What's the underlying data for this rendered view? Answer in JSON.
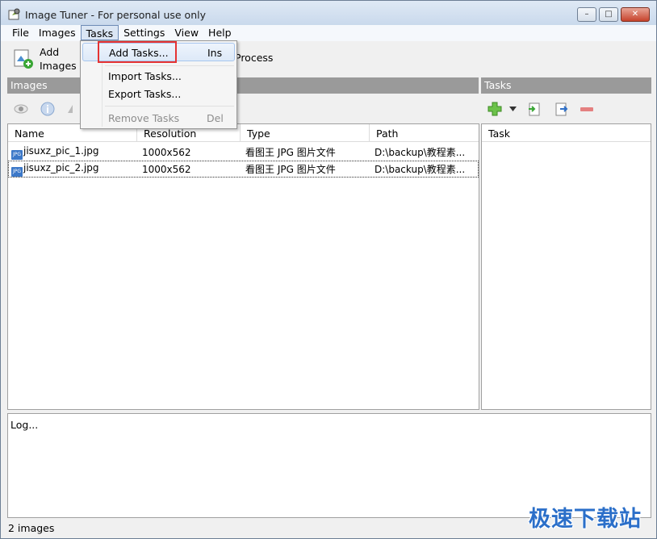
{
  "window": {
    "title": "Image Tuner - For personal use only"
  },
  "menubar": {
    "items": [
      "File",
      "Images",
      "Tasks",
      "Settings",
      "View",
      "Help"
    ],
    "active": "Tasks"
  },
  "toolbar": {
    "add_images_line1": "Add",
    "add_images_line2": "Images",
    "process_label": "Process"
  },
  "images_panel": {
    "header": "Images",
    "columns": [
      "Name",
      "Resolution",
      "Type",
      "Path"
    ],
    "rows": [
      {
        "name": "jisuxz_pic_1.jpg",
        "resolution": "1000x562",
        "type": "看图王 JPG 图片文件",
        "path": "D:\\backup\\教程素..."
      },
      {
        "name": "jisuxz_pic_2.jpg",
        "resolution": "1000x562",
        "type": "看图王 JPG 图片文件",
        "path": "D:\\backup\\教程素..."
      }
    ]
  },
  "tasks_panel": {
    "header": "Tasks",
    "columns": [
      "Task"
    ]
  },
  "dropdown": {
    "items": [
      {
        "label": "Add Tasks...",
        "shortcut": "Ins",
        "hover": true,
        "disabled": false
      },
      {
        "label": "Import Tasks...",
        "shortcut": "",
        "disabled": false
      },
      {
        "label": "Export Tasks...",
        "shortcut": "",
        "disabled": false
      },
      {
        "label": "Remove Tasks",
        "shortcut": "Del",
        "disabled": true
      }
    ]
  },
  "log": {
    "text": "Log..."
  },
  "status": {
    "text": "2 images"
  },
  "watermark": {
    "text": "极速下载站"
  },
  "icons": {
    "jpg_badge": "JPG"
  },
  "colors": {
    "panel_header": "#9a9a9a",
    "highlight": "#e53333",
    "accent_green": "#3aa635"
  }
}
